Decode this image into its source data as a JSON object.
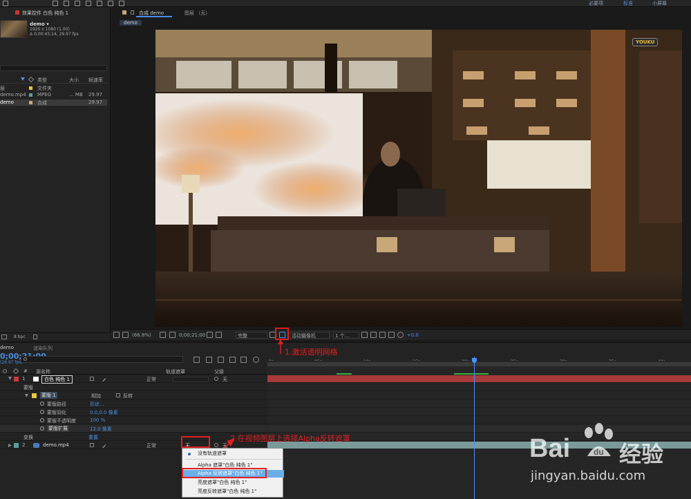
{
  "project_panel": {
    "tab_label": "效果控件 白色 纯色 1",
    "comp_name": "demo ▾",
    "comp_size": "1920 x 1080 (1.00)",
    "comp_duration": "Δ 0;00;45;14, 29.97 fps",
    "columns": [
      "类型",
      "大小",
      "帧速率"
    ],
    "rows": [
      {
        "name": "层",
        "type": "文件夹",
        "size": "",
        "fps": "",
        "color": "#e6c84a"
      },
      {
        "name": "demo.mp4",
        "type": "MPEG",
        "size": "... MB",
        "fps": "29.97",
        "color": "#5aa0a0"
      },
      {
        "name": "demo",
        "type": "合成",
        "size": "",
        "fps": "29.97",
        "color": "#c8a878"
      }
    ],
    "bpc": "8 bpc"
  },
  "toolbar": {
    "workspace_tabs": [
      "必要项",
      "标准",
      "小屏幕"
    ]
  },
  "composition": {
    "tab_label": "合成 demo",
    "layer_tab": "图层 （无）",
    "breadcrumb": "demo",
    "watermark_logo": "YOUKU",
    "footer": {
      "zoom": "(66.8%)",
      "timecode": "0;00;21;00",
      "resolution": "完整",
      "camera": "活动摄像机",
      "views": "1 个...",
      "exposure": "+0.0"
    }
  },
  "timeline": {
    "tab_name": "demo",
    "render_queue": "渲染队列",
    "current_time": "0;00;21;00",
    "fps_note": "(29.97 fps)",
    "search_placeholder": "",
    "headers": {
      "layer_name": "源名称",
      "track_matte": "轨道遮罩",
      "parent": "父级"
    },
    "ruler_ticks": [
      "0s",
      "05s",
      "10s",
      "15s",
      "20s",
      "25s",
      "30s",
      "35s",
      "40s"
    ],
    "layers": [
      {
        "num": "1",
        "name": "白色 纯色 1",
        "mode": "正常",
        "parent": "无",
        "color": "#c83a3a"
      },
      {
        "num": "2",
        "name": "demo.mp4",
        "mode": "正常",
        "matte": "无",
        "parent": "无",
        "color": "#5aa0a0"
      }
    ],
    "mask": {
      "group": "蒙版",
      "name": "蒙版 1",
      "mode": "相加",
      "invert": "反转",
      "props": [
        {
          "label": "蒙版路径",
          "value": "形状..."
        },
        {
          "label": "蒙版羽化",
          "value": "0.0,0.0 像素"
        },
        {
          "label": "蒙版不透明度",
          "value": "100 %"
        },
        {
          "label": "蒙版扩展",
          "value": "12.0 像素"
        }
      ],
      "transform": "变换",
      "reset": "重置"
    },
    "matte_menu": [
      {
        "label": "没有轨道遮罩",
        "selected": true
      },
      {
        "label": "Alpha 遮罩\"白色 纯色 1\"",
        "selected": false
      },
      {
        "label": "Alpha 反转遮罩\"白色 纯色 1\"",
        "selected": false,
        "highlighted": true
      },
      {
        "label": "亮度遮罩\"白色 纯色 1\"",
        "selected": false
      },
      {
        "label": "亮度反转遮罩\"白色 纯色 1\"",
        "selected": false
      }
    ]
  },
  "annotations": {
    "step1": "1.激活透明网格",
    "step2": "2.在视频图层上选择Alpha反转遮罩"
  },
  "watermark": {
    "brand": "Bai",
    "brand2": "经验",
    "url": "jingyan.baidu.com"
  },
  "colors": {
    "accent": "#4a90ff",
    "annotation": "#e02020",
    "layer1_bar": "#a83a3a",
    "layer2_bar": "#7a9a9a"
  }
}
